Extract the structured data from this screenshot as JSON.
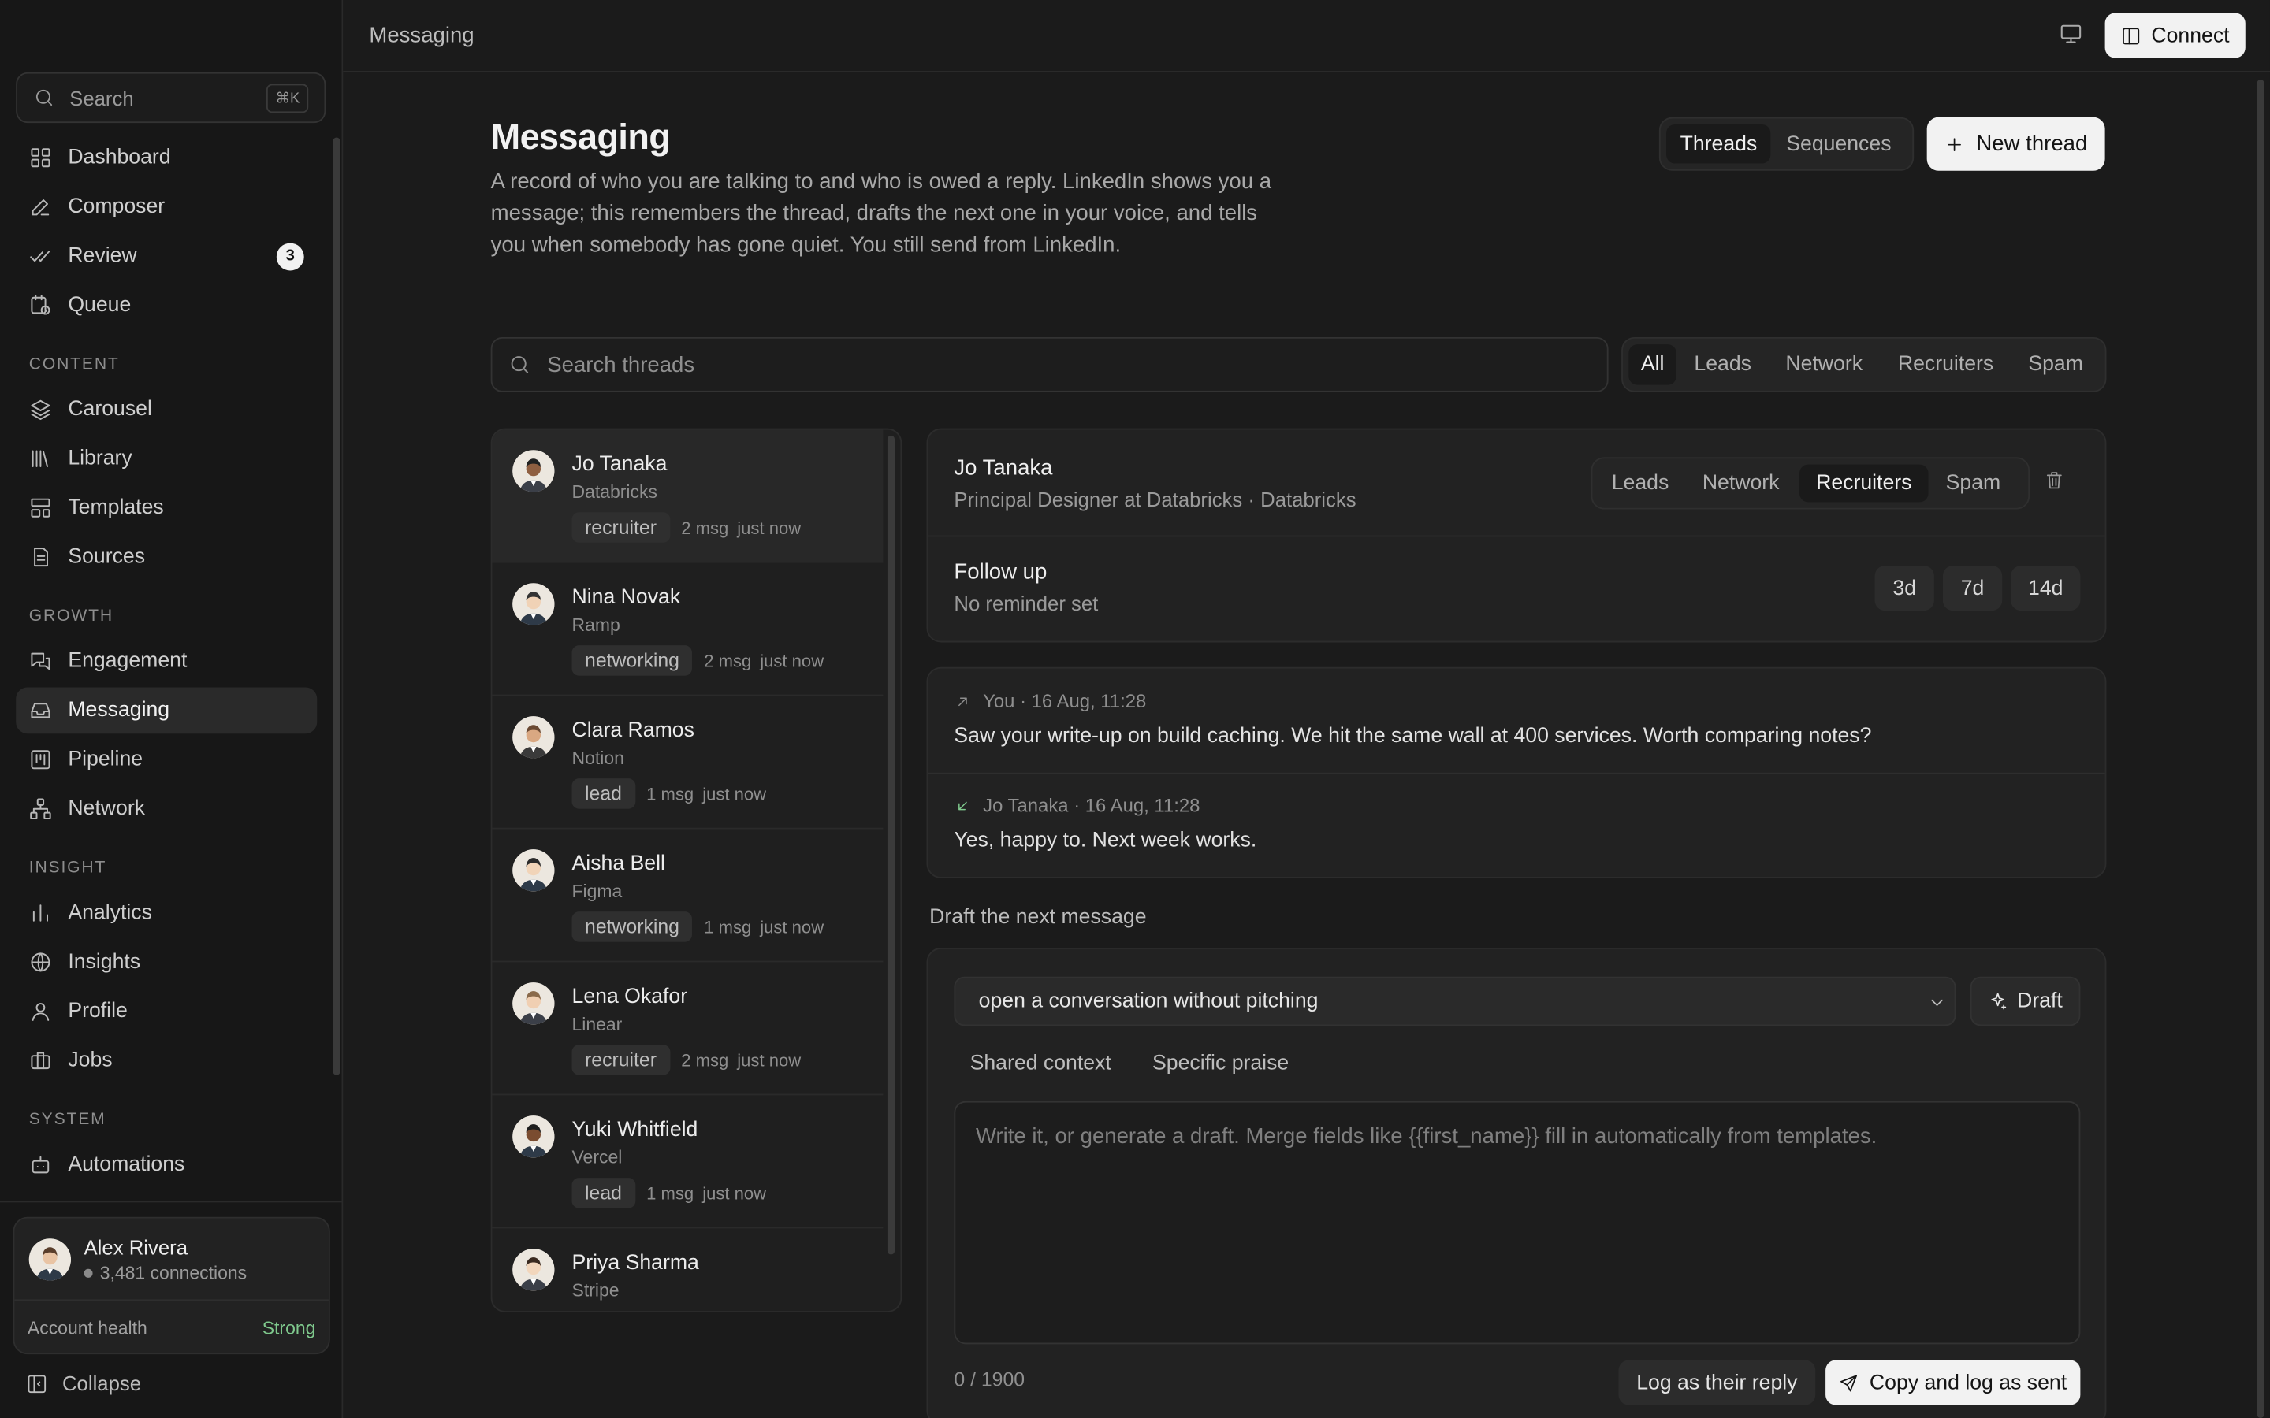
{
  "topbar": {
    "breadcrumb": "Messaging",
    "connect_label": "Connect"
  },
  "sidebar": {
    "search_label": "Search",
    "search_shortcut": "⌘K",
    "items_top": [
      {
        "label": "Dashboard",
        "icon": "dashboard-icon"
      },
      {
        "label": "Composer",
        "icon": "pencil-icon"
      },
      {
        "label": "Review",
        "icon": "double-check-icon",
        "badge": "3"
      },
      {
        "label": "Queue",
        "icon": "clock-calendar-icon"
      }
    ],
    "sections": [
      {
        "label": "CONTENT",
        "items": [
          {
            "label": "Carousel",
            "icon": "layers-icon"
          },
          {
            "label": "Library",
            "icon": "library-icon"
          },
          {
            "label": "Templates",
            "icon": "template-icon"
          },
          {
            "label": "Sources",
            "icon": "document-icon"
          }
        ]
      },
      {
        "label": "GROWTH",
        "items": [
          {
            "label": "Engagement",
            "icon": "chat-bubbles-icon"
          },
          {
            "label": "Messaging",
            "icon": "inbox-icon",
            "active": true
          },
          {
            "label": "Pipeline",
            "icon": "kanban-icon"
          },
          {
            "label": "Network",
            "icon": "network-icon"
          }
        ]
      },
      {
        "label": "INSIGHT",
        "items": [
          {
            "label": "Analytics",
            "icon": "bar-chart-icon"
          },
          {
            "label": "Insights",
            "icon": "globe-icon"
          },
          {
            "label": "Profile",
            "icon": "user-icon"
          },
          {
            "label": "Jobs",
            "icon": "briefcase-icon"
          }
        ]
      },
      {
        "label": "SYSTEM",
        "items": [
          {
            "label": "Automations",
            "icon": "robot-icon"
          }
        ]
      }
    ],
    "user": {
      "name": "Alex Rivera",
      "connections": "3,481 connections",
      "health_label": "Account health",
      "health_value": "Strong"
    },
    "collapse_label": "Collapse"
  },
  "header": {
    "title": "Messaging",
    "description": "A record of who you are talking to and who is owed a reply. LinkedIn shows you a message; this remembers the thread, drafts the next one in your voice, and tells you when somebody has gone quiet. You still send from LinkedIn.",
    "view_tabs": [
      "Threads",
      "Sequences"
    ],
    "view_active": "Threads",
    "new_thread_label": "New thread"
  },
  "filters": {
    "search_placeholder": "Search threads",
    "tabs": [
      "All",
      "Leads",
      "Network",
      "Recruiters",
      "Spam"
    ],
    "active": "All"
  },
  "threads": [
    {
      "name": "Jo Tanaka",
      "company": "Databricks",
      "tag": "recruiter",
      "count": "2 msg",
      "time": "just now",
      "active": true
    },
    {
      "name": "Nina Novak",
      "company": "Ramp",
      "tag": "networking",
      "count": "2 msg",
      "time": "just now"
    },
    {
      "name": "Clara Ramos",
      "company": "Notion",
      "tag": "lead",
      "count": "1 msg",
      "time": "just now"
    },
    {
      "name": "Aisha Bell",
      "company": "Figma",
      "tag": "networking",
      "count": "1 msg",
      "time": "just now"
    },
    {
      "name": "Lena Okafor",
      "company": "Linear",
      "tag": "recruiter",
      "count": "2 msg",
      "time": "just now"
    },
    {
      "name": "Yuki Whitfield",
      "company": "Vercel",
      "tag": "lead",
      "count": "1 msg",
      "time": "just now"
    },
    {
      "name": "Priya Sharma",
      "company": "Stripe",
      "tag": "",
      "count": "",
      "time": ""
    }
  ],
  "detail": {
    "name": "Jo Tanaka",
    "role": "Principal Designer at Databricks · Databricks",
    "categories": [
      "Leads",
      "Network",
      "Recruiters",
      "Spam"
    ],
    "category_active": "Recruiters",
    "followup_title": "Follow up",
    "followup_status": "No reminder set",
    "followup_options": [
      "3d",
      "7d",
      "14d"
    ],
    "messages": [
      {
        "direction": "outgoing",
        "meta": "You · 16 Aug, 11:28",
        "text": "Saw your write-up on build caching. We hit the same wall at 400 services. Worth comparing notes?"
      },
      {
        "direction": "incoming",
        "meta": "Jo Tanaka · 16 Aug, 11:28",
        "text": "Yes, happy to. Next week works."
      }
    ]
  },
  "draft": {
    "section_label": "Draft the next message",
    "intent_value": "open a conversation without pitching",
    "draft_button": "Draft",
    "context_tabs": [
      "Shared context",
      "Specific praise"
    ],
    "editor_placeholder": "Write it, or generate a draft. Merge fields like {{first_name}} fill in automatically from templates.",
    "counter": "0 / 1900",
    "log_reply_label": "Log as their reply",
    "copy_log_label": "Copy and log as sent"
  }
}
